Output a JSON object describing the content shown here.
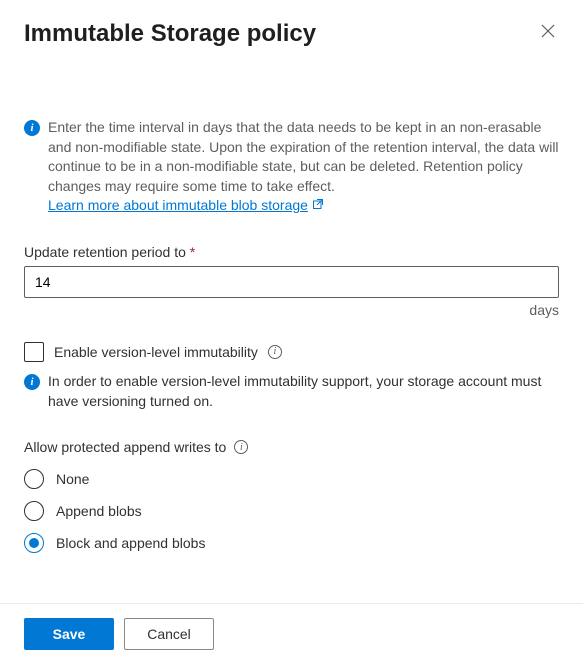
{
  "header": {
    "title": "Immutable Storage policy"
  },
  "info": {
    "text": "Enter the time interval in days that the data needs to be kept in an non-erasable and non-modifiable state. Upon the expiration of the retention interval, the data will continue to be in a non-modifiable state, but can be deleted. Retention policy changes may require some time to take effect.",
    "link": "Learn more about immutable blob storage"
  },
  "retention": {
    "label": "Update retention period to",
    "value": "14",
    "unit": "days"
  },
  "versionLevel": {
    "label": "Enable version-level immutability",
    "note": "In order to enable version-level immutability support, your storage account must have versioning turned on."
  },
  "appendWrites": {
    "label": "Allow protected append writes to",
    "options": [
      "None",
      "Append blobs",
      "Block and append blobs"
    ],
    "selected": 2
  },
  "footer": {
    "save": "Save",
    "cancel": "Cancel"
  }
}
